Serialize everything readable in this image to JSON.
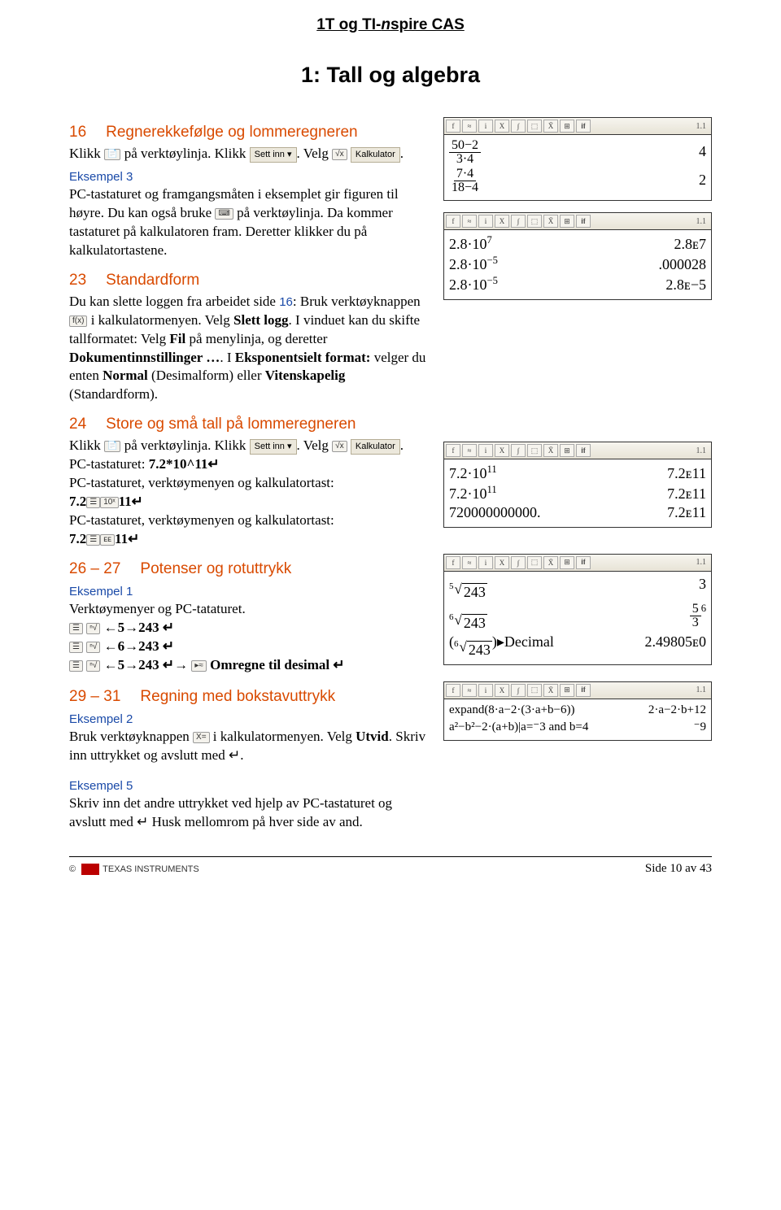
{
  "header": {
    "title_a": "1T og TI-",
    "title_i": "n",
    "title_b": "spire CAS"
  },
  "chapter_title": "1: Tall og algebra",
  "sections": {
    "s16": {
      "num": "16",
      "title": "Regnerekkefølge og lommeregneren"
    },
    "s23": {
      "num": "23",
      "title": "Standardform"
    },
    "s24": {
      "num": "24",
      "title": "Store og små tall på lommeregneren"
    },
    "s2627": {
      "num": "26 – 27",
      "title": "Potenser og rotuttrykk"
    },
    "s2931": {
      "num": "29 – 31",
      "title": "Regning med bokstavuttrykk"
    }
  },
  "labels": {
    "eksempel3": "Eksempel 3",
    "eksempel1": "Eksempel 1",
    "eksempel2": "Eksempel 2",
    "eksempel5": "Eksempel 5",
    "settinn": "Sett inn ▾",
    "kalkulator": "Kalkulator",
    "omregne": "Omregne til desimal"
  },
  "text": {
    "t16a": "Klikk ",
    "t16b": " på verktøylinja. Klikk ",
    "t16c": ". Velg ",
    "t16d": ".",
    "t16e": "PC-tastaturet og framgangsmåten i eksemplet gir figuren til høyre. Du kan også bruke ",
    "t16f": " på verktøylinja. Da kommer tastaturet på kalkulatoren fram. Deretter klikker du på kalkulatortastene.",
    "t23a": "Du kan slette loggen fra arbeidet side ",
    "t23a_num": "16",
    "t23a2": ": Bruk verktøyknappen ",
    "t23b": " i kalkulatormenyen. Velg ",
    "t23b_bold": "Slett logg",
    "t23c": ". I vinduet kan du skifte tallformatet: Velg ",
    "t23c_bold": "Fil",
    "t23d": " på menylinja, og deretter ",
    "t23d_bold": "Dokumentinnstillinger …",
    "t23e": ". I ",
    "t23e_bold": "Eksponentsielt format:",
    "t23f": " velger du enten ",
    "t23f_bold": "Normal",
    "t23g": " (Desimalform) eller ",
    "t23g_bold": "Vitenskapelig",
    "t23h": " (Standardform).",
    "t24a": "Klikk ",
    "t24b": " på verktøylinja. Klikk ",
    "t24c": ". Velg ",
    "t24d": ".",
    "t24e": "PC-tastaturet: ",
    "t24e_b": "7.2*10^11↵",
    "t24f": "PC-tastaturet, verktøymenyen og kalkulatortast:",
    "t24g_a": "7.2",
    "t24g_b": "11↵",
    "t24h": "PC-tastaturet, verktøymenyen og kalkulatortast:",
    "t24i_a": "7.2",
    "t24i_b": "11↵",
    "t26a": "Verktøymenyer og PC-tataturet.",
    "t26l1": "←5→243 ↵",
    "t26l2": "←6→243 ↵",
    "t26l3": "←5→243 ↵→",
    "t29a": "Bruk verktøyknappen ",
    "t29b": " i kalkulatormenyen. Velg ",
    "t29b_bold": "Utvid",
    "t29c": ". Skriv inn uttrykket og avslutt med ↵.",
    "t29d": "Skriv inn det andre uttrykket ved hjelp av PC-tastaturet og avslutt med ↵ Husk mellomrom på hver side av and."
  },
  "calc1": {
    "tag": "1.1",
    "r1": {
      "lhs_top": "50−2",
      "lhs_bot": "3·4",
      "rhs": "4"
    },
    "r2": {
      "lhs_top": "7·4",
      "lhs_bot": "18−4",
      "rhs": "2"
    }
  },
  "calc2": {
    "tag": "1.1",
    "r1": {
      "lhs": "2.8·10",
      "exp": "7",
      "rhs": "2.8ᴇ7"
    },
    "r2": {
      "lhs": "2.8·10",
      "exp": "−5",
      "rhs": ".000028"
    },
    "r3": {
      "lhs": "2.8·10",
      "exp": "−5",
      "rhs": "2.8ᴇ−5"
    }
  },
  "calc3": {
    "tag": "1.1",
    "r1": {
      "lhs": "7.2·10",
      "exp": "11",
      "rhs": "7.2ᴇ11"
    },
    "r2": {
      "lhs": "7.2·10",
      "exp": "11",
      "rhs": "7.2ᴇ11"
    },
    "r3": {
      "lhs": "720000000000.",
      "rhs": "7.2ᴇ11"
    }
  },
  "calc4": {
    "tag": "1.1",
    "r1": {
      "idx": "5",
      "arg": "243",
      "rhs": "3"
    },
    "r2": {
      "idx": "6",
      "arg": "243",
      "rhs_t": "5",
      "rhs_b": "3",
      "rhs_exp": "6"
    },
    "r3": {
      "idx": "6",
      "arg": "243",
      "trail": "▸Decimal",
      "rhs": "2.49805ᴇ0"
    }
  },
  "calc5": {
    "tag": "1.1",
    "r1": {
      "lhs": "expand(8·a−2·(3·a+b−6))",
      "rhs": "2·a−2·b+12"
    },
    "r2": {
      "lhs": "a²−b²−2·(a+b)|a=⁻3 and b=4",
      "rhs": "⁻9"
    }
  },
  "footer": {
    "ti": "TEXAS INSTRUMENTS",
    "page": "Side 10 av 43"
  },
  "icons": {
    "doc": "📄",
    "menu": "☰",
    "root": "√x",
    "calc": "⌨",
    "fx": "f(x)",
    "xeq": "X=",
    "tenx": "10ˣ",
    "ee": "ᴇᴇ",
    "sqrt": "ⁿ√",
    "decmenu": "▸≈"
  }
}
